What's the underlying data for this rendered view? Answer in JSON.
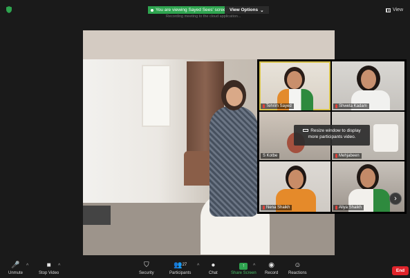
{
  "topbar": {
    "view_label": "View",
    "share_banner": "You are viewing Sayed Sees' screen",
    "view_options_label": "View Options",
    "share_subtext": "Recording meeting to the cloud application..."
  },
  "gallery": {
    "tiles": [
      {
        "name": "Tehrim Sayed"
      },
      {
        "name": "Shweta Kadam"
      },
      {
        "name": "S Kotbe"
      },
      {
        "name": "Mehjabeen"
      },
      {
        "name": "Nena Shaikh"
      },
      {
        "name": "Aliya Shaikh"
      }
    ],
    "overlay_message": "Resize window to display more participants video."
  },
  "toolbar": {
    "unmute": "Unmute",
    "stop_video": "Stop Video",
    "security": "Security",
    "participants": "Participants",
    "participant_count": "27",
    "chat": "Chat",
    "share_screen": "Share Screen",
    "record": "Record",
    "reactions": "Reactions",
    "end": "End"
  },
  "colors": {
    "share_green": "#2ea44f",
    "end_red": "#e0242b",
    "active_speaker": "#d7c24a"
  }
}
